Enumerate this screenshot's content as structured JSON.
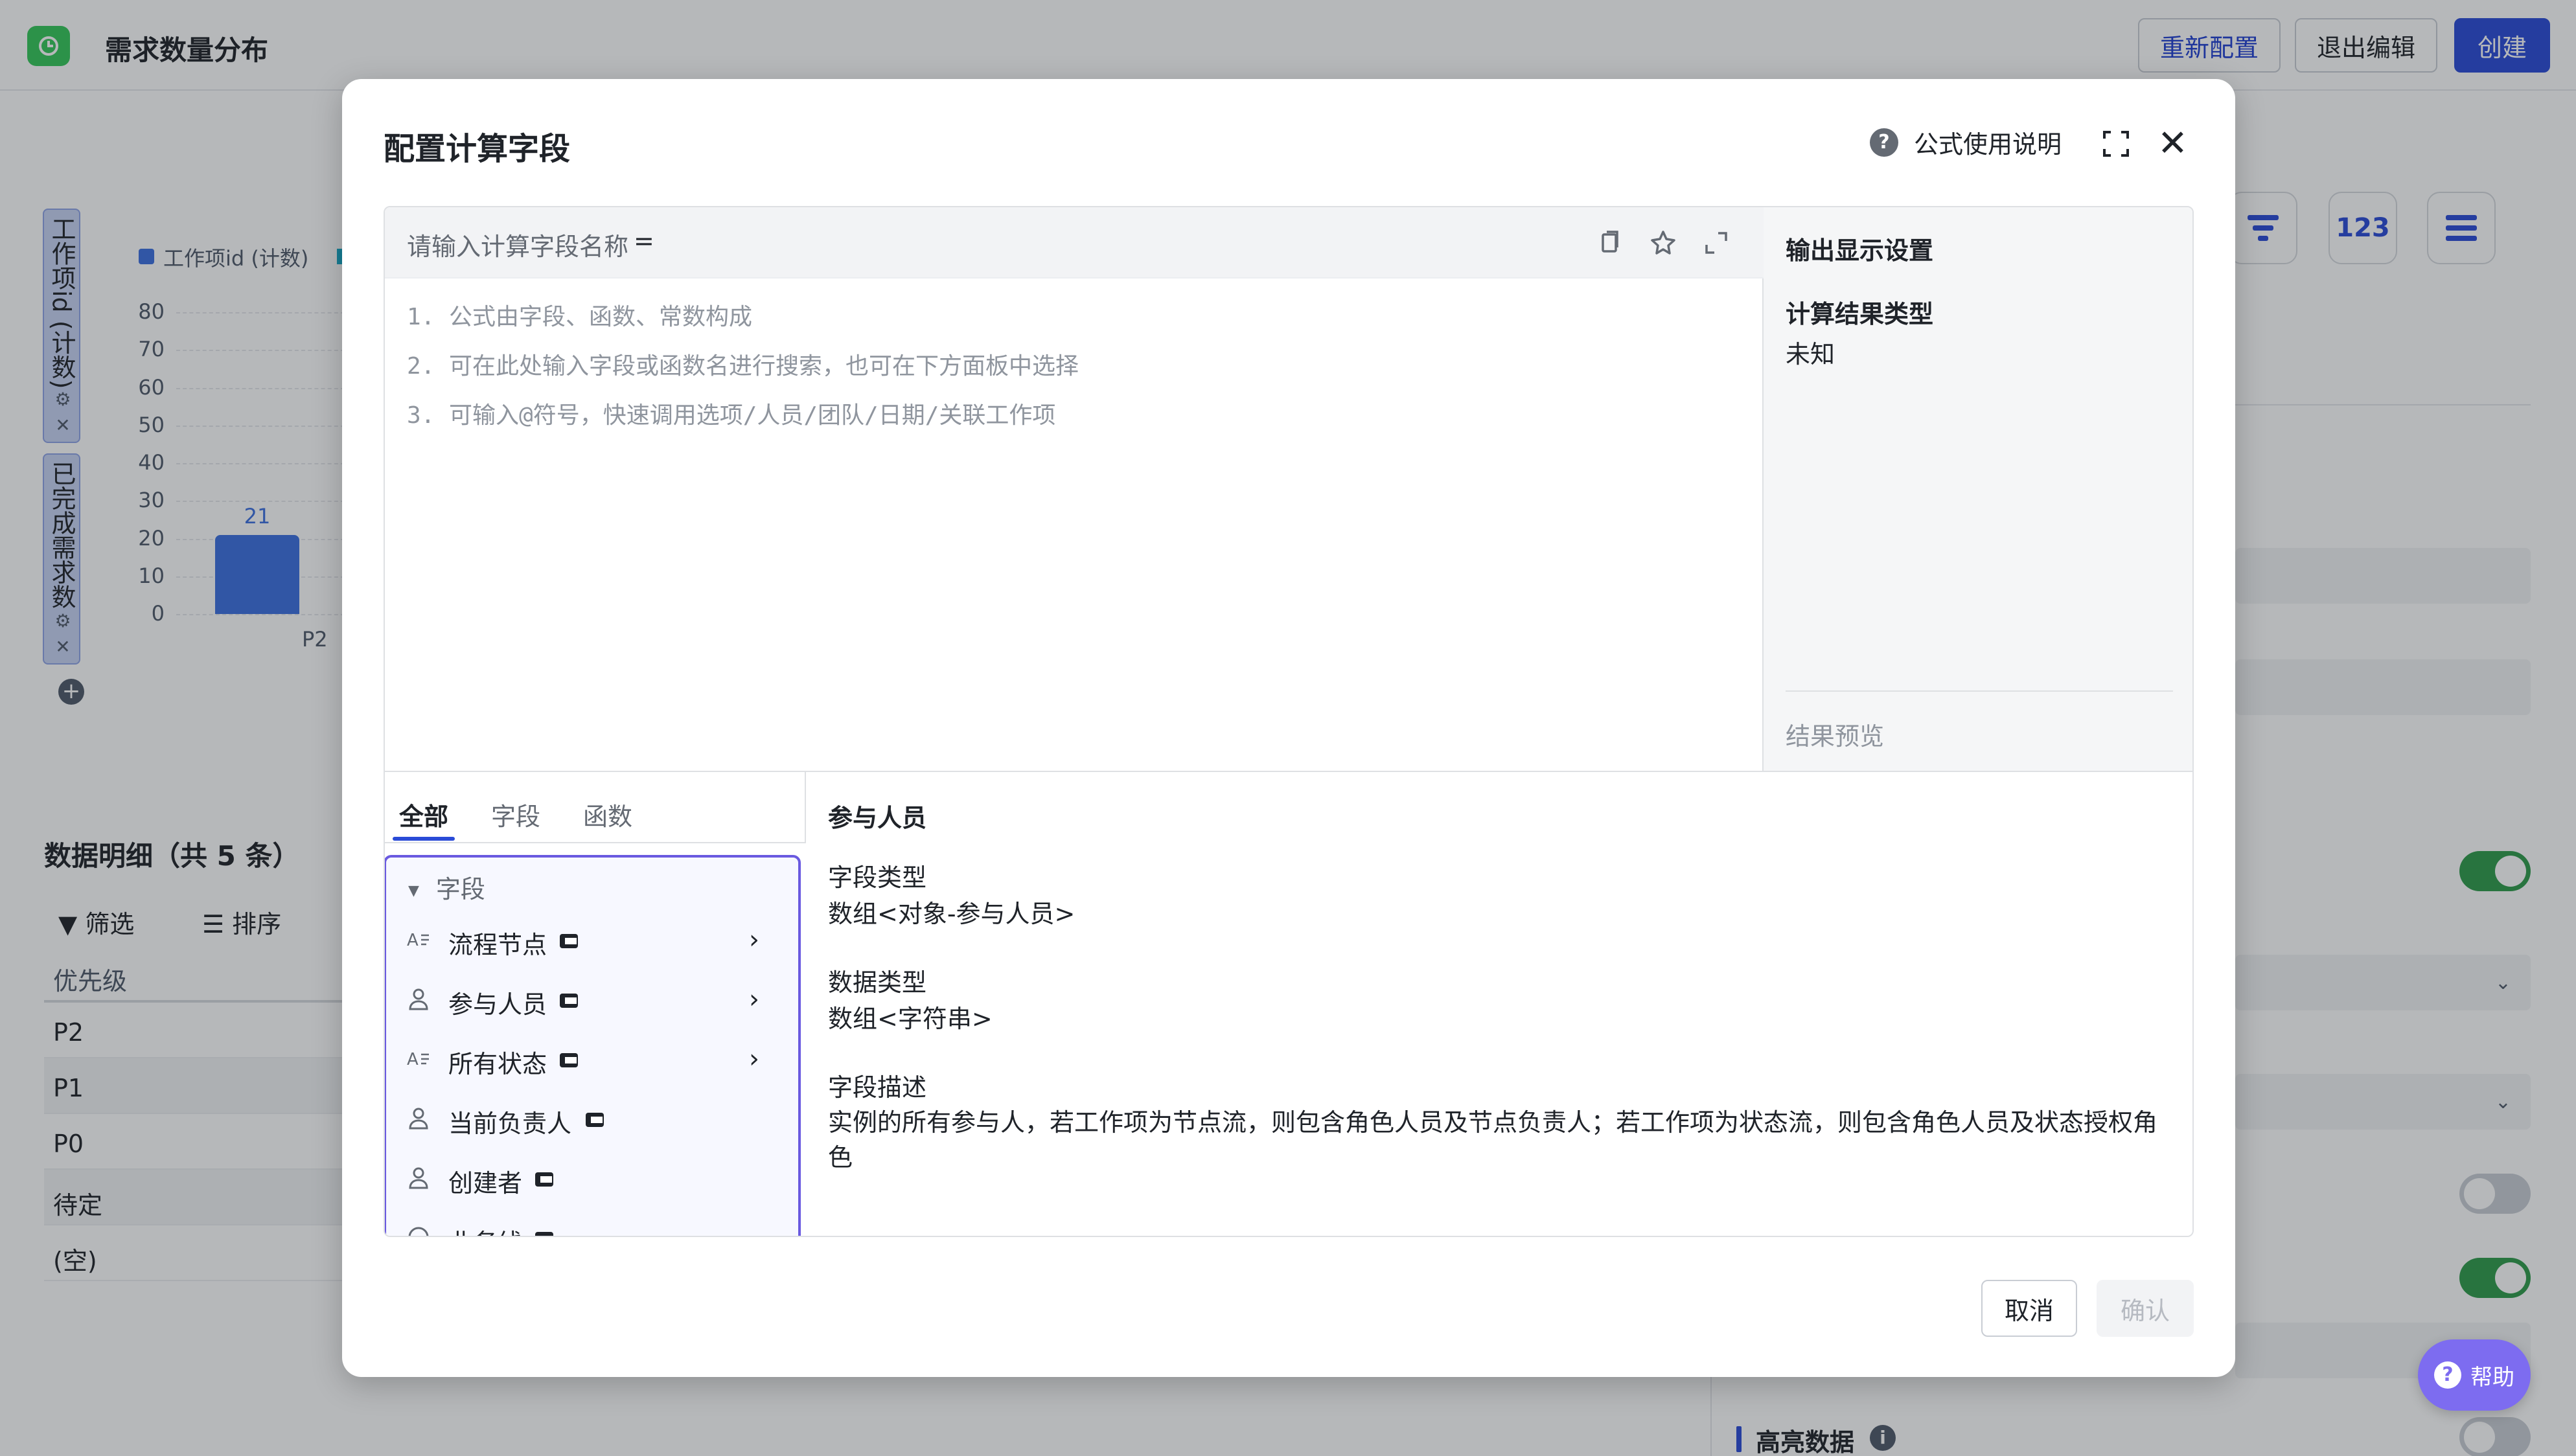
{
  "header": {
    "title": "需求数量分布",
    "reconfigure_label": "重新配置",
    "exit_edit_label": "退出编辑",
    "create_label": "创建"
  },
  "chart": {
    "axis_pill_1": "工作项id (计数)",
    "axis_pill_2": "已完成需求数",
    "legend": "工作项id (计数)",
    "y_ticks": [
      "80",
      "70",
      "60",
      "50",
      "40",
      "30",
      "20",
      "10",
      "0"
    ],
    "bar_value_label": "21",
    "x_label": "P2"
  },
  "chart_data": {
    "type": "bar",
    "categories": [
      "P2"
    ],
    "series": [
      {
        "name": "工作项id (计数)",
        "values": [
          21
        ]
      }
    ],
    "ylim": [
      0,
      80
    ]
  },
  "details": {
    "title": "数据明细（共 5 条）",
    "filter_label": "筛选",
    "sort_label": "排序",
    "column_header": "优先级",
    "rows": [
      "P2",
      "P1",
      "P0",
      "待定",
      "(空)"
    ]
  },
  "right_panel": {
    "number_icon_text": "123",
    "highlight_label": "高亮数据"
  },
  "help_float": {
    "label": "帮助"
  },
  "dialog": {
    "title": "配置计算字段",
    "help_link": "公式使用说明",
    "name_placeholder": "请输入计算字段名称",
    "name_eq": "=",
    "hints": [
      "1. 公式由字段、函数、常数构成",
      "2. 可在此处输入字段或函数名进行搜索，也可在下方面板中选择",
      "3. 可输入@符号，快速调用选项/人员/团队/日期/关联工作项"
    ],
    "output": {
      "title": "输出显示设置",
      "result_type_label": "计算结果类型",
      "result_type_value": "未知",
      "preview_label": "结果预览"
    },
    "tabs": [
      "全部",
      "字段",
      "函数"
    ],
    "group_label": "字段",
    "fields": [
      {
        "name": "流程节点",
        "icon": "text-field-icon",
        "has_arrow": true
      },
      {
        "name": "参与人员",
        "icon": "person-icon",
        "has_arrow": true
      },
      {
        "name": "所有状态",
        "icon": "text-field-icon",
        "has_arrow": true
      },
      {
        "name": "当前负责人",
        "icon": "person-icon",
        "has_arrow": false
      },
      {
        "name": "创建者",
        "icon": "person-icon",
        "has_arrow": false
      },
      {
        "name": "业务线",
        "icon": "circle-icon",
        "has_arrow": false
      }
    ],
    "detail": {
      "title": "参与人员",
      "field_type_label": "字段类型",
      "field_type_value": "数组<对象-参与人员>",
      "data_type_label": "数据类型",
      "data_type_value": "数组<字符串>",
      "desc_label": "字段描述",
      "desc_value": "实例的所有参与人，若工作项为节点流，则包含角色人员及节点负责人；若工作项为状态流，则包含角色人员及状态授权角色"
    },
    "cancel_label": "取消",
    "confirm_label": "确认"
  }
}
